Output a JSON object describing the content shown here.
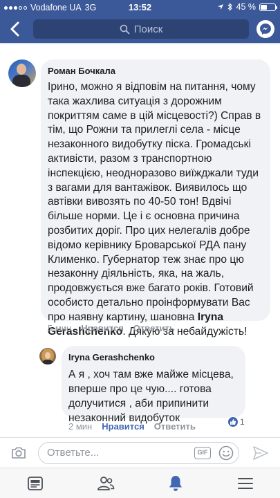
{
  "status_bar": {
    "carrier": "Vodafone UA",
    "network": "3G",
    "time": "13:52",
    "battery": "45 %",
    "battery_level": 0.45
  },
  "nav": {
    "search_placeholder": "Поиск"
  },
  "comment": {
    "author": "Роман Бочкала",
    "text_before_mention": "Ірино, можно я відповім на питання, чому така жахлива ситуація з дорожним покриттям саме в цій місцевості?) Справ в тім, що Рожни та прилеглі села - місце незаконного видобутку піска. Громадські активісти, разом з транспортною інспекцією, неодноразово виїжджали туди з вагами для вантажівок. Виявилось що автівки вивозять по 40-50 тон! Вдвічі більше норми. Це і є основна причина розбитих доріг. Про цих нелегалів добре відомо керівнику Броварської РДА пану Клименко. Губернатор теж знає про цю незаконну діяльність, яка, на жаль, продовжується вже багато років. Готовий особисто детально проінформувати Вас про наявну картину, шановна ",
    "mention": "Iryna Gerashchenko",
    "text_after_mention": ". Дякую за небайдужість!",
    "time": "5 мин",
    "like_label": "Нравится",
    "reply_label": "Ответить"
  },
  "reply": {
    "author": "Iryna Gerashchenko",
    "text": "А я , хоч там вже майже місцева, вперше про це чую.... готова долучитися , аби припинити незаконний видобуток",
    "time": "2 мин",
    "like_label": "Нравится",
    "reply_label": "Ответить",
    "like_count": "1"
  },
  "composer": {
    "placeholder": "Ответьте...",
    "gif_label": "GIF"
  },
  "colors": {
    "brand": "#3b5998",
    "liked": "#4267b2",
    "bubble": "#f0f2f5"
  }
}
